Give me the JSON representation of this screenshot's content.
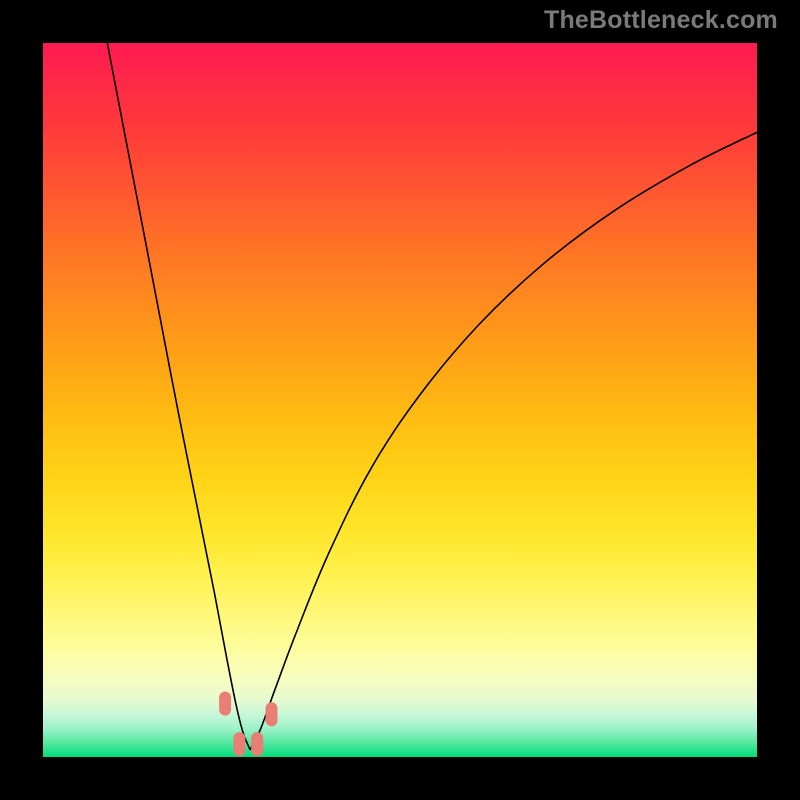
{
  "watermark": "TheBottleneck.com",
  "colors": {
    "frame": "#000000",
    "curve": "#000000",
    "marker": "#e87e74",
    "gradient_top": "#ff1a52",
    "gradient_mid": "#ffd116",
    "gradient_bottom": "#00de78"
  },
  "chart_data": {
    "type": "line",
    "title": "",
    "xlabel": "",
    "ylabel": "",
    "xlim": [
      0,
      1
    ],
    "ylim": [
      0,
      1
    ],
    "note": "Axes are unlabeled; values are normalized fractions of the plot area. y≈0 at the dip (green/good), y→1 toward top (red/bad). The minimum of the curve sits near x≈0.29.",
    "series": [
      {
        "name": "left-branch",
        "x": [
          0.09,
          0.115,
          0.14,
          0.165,
          0.19,
          0.215,
          0.24,
          0.258,
          0.27,
          0.28,
          0.29
        ],
        "y": [
          1.0,
          0.87,
          0.74,
          0.61,
          0.48,
          0.355,
          0.23,
          0.135,
          0.075,
          0.035,
          0.01
        ]
      },
      {
        "name": "right-branch",
        "x": [
          0.29,
          0.305,
          0.325,
          0.355,
          0.4,
          0.46,
          0.53,
          0.61,
          0.7,
          0.8,
          0.905,
          1.0
        ],
        "y": [
          0.01,
          0.04,
          0.095,
          0.175,
          0.285,
          0.405,
          0.51,
          0.605,
          0.69,
          0.765,
          0.828,
          0.875
        ]
      }
    ],
    "markers": {
      "name": "highlighted-points",
      "shape": "rounded-capsule",
      "points": [
        {
          "x": 0.255,
          "y": 0.075
        },
        {
          "x": 0.275,
          "y": 0.018
        },
        {
          "x": 0.3,
          "y": 0.018
        },
        {
          "x": 0.32,
          "y": 0.06
        }
      ]
    }
  }
}
